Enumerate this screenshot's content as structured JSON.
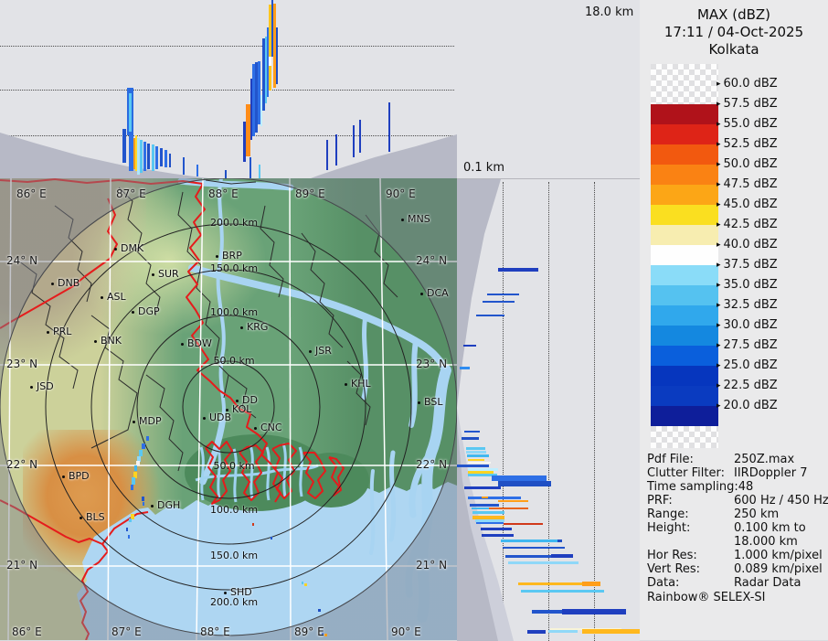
{
  "colors": {
    "accent_red_border": "#e51c1c",
    "sea": "#aed6f2",
    "river": "#a8d4f2",
    "panel_bg": "#e2e3e7",
    "blind_cone": "#b7b9c6"
  },
  "top_panel": {
    "max_height_label": "18.0 km",
    "bars": [
      [
        139,
        7,
        96,
        148,
        "#2a6be0"
      ],
      [
        141,
        3,
        102,
        144,
        "#5ac8f2"
      ],
      [
        134,
        4,
        141,
        178,
        "#2255cc"
      ],
      [
        141,
        5,
        148,
        187,
        "#2e6fe6"
      ],
      [
        146,
        2,
        151,
        185,
        "#ff9e1a"
      ],
      [
        148,
        2,
        148,
        187,
        "#ffd92b"
      ],
      [
        150,
        3,
        151,
        191,
        "#aee6fa"
      ],
      [
        153,
        3,
        153,
        189,
        "#5ac8f2"
      ],
      [
        157,
        3,
        155,
        187,
        "#2e6fe6"
      ],
      [
        161,
        3,
        157,
        185,
        "#1f4fc4"
      ],
      [
        166,
        3,
        158,
        187,
        "#5ac8f2"
      ],
      [
        170,
        3,
        160,
        185,
        "#2e6fe6"
      ],
      [
        175,
        3,
        162,
        182,
        "#2255cc"
      ],
      [
        180,
        3,
        164,
        183,
        "#2e6fe6"
      ],
      [
        185,
        2,
        168,
        183,
        "#1f4fc4"
      ],
      [
        200,
        2,
        172,
        191,
        "#2255cc"
      ],
      [
        215,
        2,
        180,
        193,
        "#2e6fe6"
      ],
      [
        246,
        2,
        186,
        195,
        "#1f4fc4"
      ],
      [
        266,
        3,
        133,
        177,
        "#1f3fbf"
      ],
      [
        269,
        5,
        114,
        171,
        "#ff8c19"
      ],
      [
        274,
        2,
        86,
        153,
        "#1f3fbf"
      ],
      [
        276,
        3,
        70,
        149,
        "#2e6fe6"
      ],
      [
        279,
        3,
        68,
        145,
        "#2255cc"
      ],
      [
        282,
        3,
        67,
        136,
        "#2e6fe6"
      ],
      [
        285,
        2,
        104,
        138,
        "#bfefff"
      ],
      [
        287,
        3,
        42,
        121,
        "#2255cc"
      ],
      [
        290,
        2,
        40,
        113,
        "#5ac8f2"
      ],
      [
        292,
        2,
        30,
        106,
        "#2e6fe6"
      ],
      [
        294,
        3,
        5,
        99,
        "#ffc61e"
      ],
      [
        294,
        3,
        62,
        72,
        "#ffffff"
      ],
      [
        297,
        2,
        0,
        62,
        "#2255cc"
      ],
      [
        299,
        3,
        4,
        96,
        "#ff9e1a"
      ],
      [
        302,
        2,
        30,
        92,
        "#1f4fc4"
      ],
      [
        273,
        2,
        172,
        195,
        "#2255cc"
      ],
      [
        283,
        2,
        180,
        195,
        "#5ac8f2"
      ],
      [
        357,
        2,
        153,
        186,
        "#1f3fbf"
      ],
      [
        367,
        2,
        147,
        181,
        "#1f3fbf"
      ],
      [
        386,
        2,
        137,
        172,
        "#1f3fbf"
      ],
      [
        393,
        2,
        131,
        167,
        "#1f3fbf"
      ],
      [
        425,
        2,
        112,
        166,
        "#1f3fbf"
      ]
    ]
  },
  "right_panel": {
    "min_height_label": "0.1 km",
    "bars": [
      [
        97,
        4,
        45,
        89,
        "#1f3fbf"
      ],
      [
        125,
        2,
        33,
        68,
        "#2255cc"
      ],
      [
        133,
        2,
        28,
        63,
        "#2255cc"
      ],
      [
        148,
        2,
        21,
        52,
        "#2255cc"
      ],
      [
        181,
        2,
        7,
        21,
        "#1f3fbf"
      ],
      [
        205,
        3,
        3,
        14,
        "#2e8cf0"
      ],
      [
        275,
        2,
        8,
        25,
        "#2255cc"
      ],
      [
        282,
        3,
        5,
        24,
        "#1f4fc4"
      ],
      [
        293,
        3,
        10,
        31,
        "#5ac8f2"
      ],
      [
        297,
        3,
        10,
        32,
        "#8fd8f8"
      ],
      [
        301,
        3,
        11,
        35,
        "#40b8f0"
      ],
      [
        306,
        2,
        12,
        30,
        "#ffd321"
      ],
      [
        309,
        2,
        12,
        37,
        "#f6f6f0"
      ],
      [
        312,
        3,
        0,
        35,
        "#2255cc"
      ],
      [
        316,
        3,
        12,
        45,
        "#bfefff"
      ],
      [
        319,
        3,
        12,
        40,
        "#ffd321"
      ],
      [
        322,
        3,
        12,
        44,
        "#5ac8f2"
      ],
      [
        324,
        6,
        38,
        98,
        "#2e6fe6"
      ],
      [
        330,
        6,
        45,
        103,
        "#1f4fc4"
      ],
      [
        336,
        3,
        8,
        48,
        "#1f3fbf"
      ],
      [
        347,
        3,
        12,
        70,
        "#2e6fe6"
      ],
      [
        347,
        2,
        27,
        34,
        "#ff9e1a"
      ],
      [
        351,
        2,
        45,
        78,
        "#ff9e1a"
      ],
      [
        355,
        3,
        14,
        46,
        "#2255cc"
      ],
      [
        359,
        2,
        16,
        35,
        "#40b8f0"
      ],
      [
        359,
        2,
        35,
        78,
        "#e8641e"
      ],
      [
        363,
        3,
        17,
        52,
        "#5ac8f2"
      ],
      [
        368,
        4,
        17,
        52,
        "#ffb81e"
      ],
      [
        372,
        3,
        20,
        52,
        "#8fd8f8"
      ],
      [
        375,
        2,
        21,
        51,
        "#2e6fe6"
      ],
      [
        376,
        2,
        51,
        94,
        "#d0391a"
      ],
      [
        381,
        3,
        26,
        60,
        "#1f3fbf"
      ],
      [
        388,
        3,
        27,
        62,
        "#1f3fbf"
      ],
      [
        394,
        3,
        48,
        110,
        "#40b8f0"
      ],
      [
        394,
        3,
        110,
        115,
        "#1f4fc4"
      ],
      [
        402,
        2,
        50,
        118,
        "#2255cc"
      ],
      [
        411,
        3,
        53,
        127,
        "#2255cc"
      ],
      [
        410,
        4,
        103,
        127,
        "#1f3fbf"
      ],
      [
        418,
        3,
        56,
        133,
        "#8fd8f8"
      ],
      [
        441,
        3,
        67,
        157,
        "#ffb81e"
      ],
      [
        440,
        5,
        137,
        157,
        "#ff9e1a"
      ],
      [
        449,
        3,
        70,
        161,
        "#5ac8f2"
      ],
      [
        471,
        4,
        82,
        185,
        "#2255cc"
      ],
      [
        470,
        6,
        115,
        185,
        "#1f3fbf"
      ],
      [
        493,
        4,
        77,
        97,
        "#1f3fbf"
      ],
      [
        493,
        3,
        100,
        132,
        "#8fd8f8"
      ],
      [
        491,
        2,
        102,
        180,
        "#f8f4d8"
      ],
      [
        492,
        5,
        137,
        200,
        "#ffb81e"
      ]
    ]
  },
  "map": {
    "meridians": [
      [
        "86° E",
        12,
        9
      ],
      [
        "87° E",
        121,
        118
      ],
      [
        "88° E",
        222,
        215
      ],
      [
        "89° E",
        317,
        318
      ],
      [
        "90° E",
        416,
        424
      ]
    ],
    "parallels": [
      [
        "24° N",
        91
      ],
      [
        "23° N",
        204
      ],
      [
        "22° N",
        314
      ],
      [
        "21° N",
        424
      ]
    ],
    "ring_radii": [
      50,
      100,
      150,
      200,
      250
    ],
    "ring_labels_north": [
      [
        "200.0 km",
        48
      ],
      [
        "150.0 km",
        98
      ],
      [
        "100.0 km",
        146
      ],
      [
        "50.0 km",
        199
      ]
    ],
    "ring_labels_south": [
      [
        "50.0 km",
        314
      ],
      [
        "100.0 km",
        362
      ],
      [
        "150.0 km",
        412
      ],
      [
        "200.0 km",
        463
      ]
    ],
    "cities": [
      [
        "DMK",
        126,
        77
      ],
      [
        "BRP",
        237,
        85
      ],
      [
        "SUR",
        167,
        105
      ],
      [
        "DNB",
        57,
        115
      ],
      [
        "ASL",
        111,
        130
      ],
      [
        "DGP",
        145,
        146
      ],
      [
        "KRG",
        264,
        163
      ],
      [
        "PRL",
        52,
        168
      ],
      [
        "BNK",
        104,
        178
      ],
      [
        "BDW",
        199,
        181
      ],
      [
        "JSR",
        339,
        189
      ],
      [
        "KHL",
        378,
        225
      ],
      [
        "JSD",
        34,
        228
      ],
      [
        "MNS",
        440,
        45
      ],
      [
        "DCA",
        461,
        126
      ],
      [
        "BSL",
        458,
        245
      ],
      [
        "DD",
        259,
        243
      ],
      [
        "KOL",
        248,
        253
      ],
      [
        "UDB",
        223,
        262
      ],
      [
        "CNC",
        279,
        273
      ],
      [
        "MDP",
        146,
        266
      ],
      [
        "BPD",
        69,
        326
      ],
      [
        "BLS",
        88,
        371
      ],
      [
        "DGH",
        166,
        358
      ],
      [
        "SHD",
        246,
        453
      ]
    ],
    "echo_specks": [
      [
        160,
        282,
        3,
        5,
        "#2e6fe6"
      ],
      [
        155,
        290,
        4,
        6,
        "#2e6fe6"
      ],
      [
        152,
        297,
        4,
        7,
        "#5ac8f2"
      ],
      [
        150,
        304,
        4,
        6,
        "#8fd8f8"
      ],
      [
        149,
        309,
        4,
        5,
        "#f2f2f2"
      ],
      [
        147,
        314,
        3,
        6,
        "#40b8f0"
      ],
      [
        146,
        321,
        4,
        7,
        "#ffd321"
      ],
      [
        144,
        327,
        4,
        8,
        "#5ac8f2"
      ],
      [
        143,
        335,
        3,
        6,
        "#2e6fe6"
      ],
      [
        155,
        348,
        3,
        5,
        "#2255cc"
      ],
      [
        156,
        354,
        2,
        4,
        "#2e6fe6"
      ],
      [
        143,
        367,
        4,
        6,
        "#ffd321"
      ],
      [
        141,
        372,
        3,
        4,
        "#5ac8f2"
      ],
      [
        138,
        382,
        2,
        4,
        "#2255cc"
      ],
      [
        140,
        390,
        2,
        4,
        "#2e6fe6"
      ],
      [
        276,
        377,
        2,
        3,
        "#d0391a"
      ],
      [
        296,
        392,
        2,
        3,
        "#2255cc"
      ],
      [
        330,
        441,
        2,
        3,
        "#5ac8f2"
      ],
      [
        333,
        443,
        3,
        3,
        "#ffd321"
      ],
      [
        348,
        471,
        3,
        3,
        "#1f4fc4"
      ],
      [
        352,
        497,
        2,
        3,
        "#2255cc"
      ],
      [
        355,
        498,
        3,
        3,
        "#ff9e1a"
      ]
    ]
  },
  "sidebar": {
    "title": "MAX (dBZ)",
    "datetime": "17:11 / 04-Oct-2025",
    "station": "Kolkata",
    "legend": {
      "entries": [
        "60.0 dBZ",
        "57.5 dBZ",
        "55.0 dBZ",
        "52.5 dBZ",
        "50.0 dBZ",
        "47.5 dBZ",
        "45.0 dBZ",
        "42.5 dBZ",
        "40.0 dBZ",
        "37.5 dBZ",
        "35.0 dBZ",
        "32.5 dBZ",
        "30.0 dBZ",
        "27.5 dBZ",
        "25.0 dBZ",
        "22.5 dBZ",
        "20.0 dBZ"
      ],
      "swatches": [
        "#b0121a",
        "#de2417",
        "#f2590f",
        "#fa8213",
        "#fca616",
        "#fadf20",
        "#f7edb0",
        "#fefefe",
        "#8adcf8",
        "#55c2f0",
        "#30a8ec",
        "#1488e0",
        "#0a5fdc",
        "#0636be",
        "#0a3bc0",
        "#0e1e9a"
      ]
    },
    "info": [
      [
        "Pdf File:",
        "250Z.max"
      ],
      [
        "Clutter Filter:",
        "IIRDoppler 7"
      ],
      [
        "Time sampling:48",
        ""
      ],
      [
        "PRF:",
        "600 Hz / 450 Hz"
      ],
      [
        "Range:",
        "250 km"
      ],
      [
        "Height:",
        "0.100 km to"
      ],
      [
        "",
        "18.000 km"
      ],
      [
        "Hor Res:",
        "1.000 km/pixel"
      ],
      [
        "Vert Res:",
        "0.089 km/pixel"
      ],
      [
        "Data:",
        "Radar Data"
      ]
    ],
    "footer": "Rainbow® SELEX-SI"
  }
}
